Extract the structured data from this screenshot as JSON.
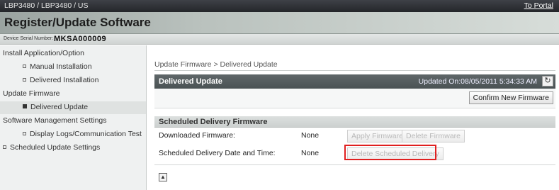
{
  "topbar": {
    "model": "LBP3480 / LBP3480 / US",
    "portal_link": "To Portal"
  },
  "title": "Register/Update Software",
  "serial": {
    "label": "Device Serial Number:",
    "value": "MKSA000009"
  },
  "sidebar": {
    "items": [
      {
        "label": "Install Application/Option",
        "type": "section"
      },
      {
        "label": "Manual Installation",
        "type": "sub"
      },
      {
        "label": "Delivered Installation",
        "type": "sub"
      },
      {
        "label": "Update Firmware",
        "type": "section"
      },
      {
        "label": "Delivered Update",
        "type": "sub",
        "selected": true
      },
      {
        "label": "Software Management Settings",
        "type": "section"
      },
      {
        "label": "Display Logs/Communication Test",
        "type": "sub"
      },
      {
        "label": "Scheduled Update Settings",
        "type": "top"
      }
    ]
  },
  "main": {
    "breadcrumb": "Update Firmware > Delivered Update",
    "panel_title": "Delivered Update",
    "updated_on": "Updated On:08/05/2011 5:34:33 AM",
    "confirm_button": "Confirm New Firmware",
    "scheduled": {
      "header": "Scheduled Delivery Firmware",
      "downloaded_label": "Downloaded Firmware:",
      "downloaded_value": "None",
      "apply_button": "Apply Firmware",
      "delete_firmware_button": "Delete Firmware",
      "date_label": "Scheduled Delivery Date and Time:",
      "date_value": "None",
      "delete_scheduled_button": "Delete Scheduled Delivery"
    }
  },
  "colors": {
    "highlight": "#e02020",
    "header_dark": "#4a5254"
  },
  "icons": {
    "refresh": "refresh-icon",
    "top": "to-top-icon"
  }
}
